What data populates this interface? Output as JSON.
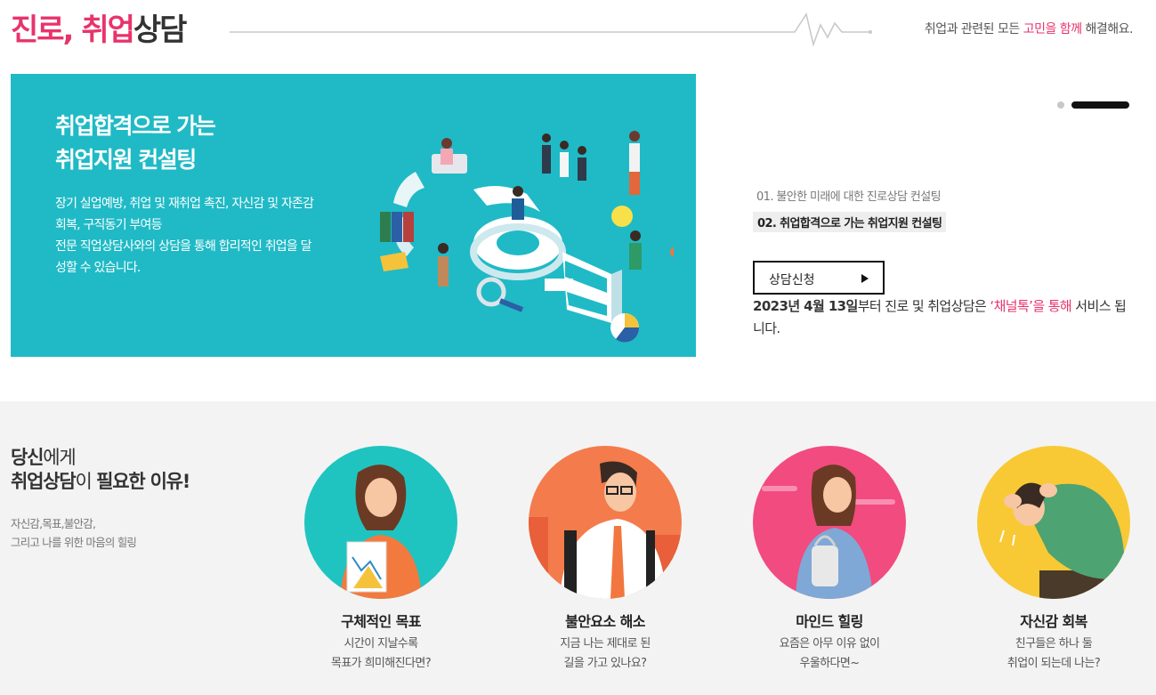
{
  "header": {
    "title_pink": "진로, 취업",
    "title_dark": "상담",
    "tagline_pre": "취업과 관련된 모든 ",
    "tagline_pink": "고민을 함께",
    "tagline_post": " 해결해요."
  },
  "banner": {
    "title_line1": "취업합격으로 가는",
    "title_line2": "취업지원 컨설팅",
    "desc_line1": "장기 실업예방, 취업 및 재취업 촉진, 자신감 및 자존감",
    "desc_line2": "회복, 구직동기 부여등",
    "desc_line3": "전문 직업상담사와의 상담을 통해 합리적인 취업을 달",
    "desc_line4": "성할 수 있습니다."
  },
  "slider": {
    "items": [
      {
        "label": "01. 불안한 미래에 대한 진로상담 컨설팅"
      },
      {
        "label": "02. 취업합격으로 가는 취업지원 컨설팅"
      }
    ],
    "active_index": 2,
    "total": 2
  },
  "consult": {
    "button_label": "상담신청",
    "notice_bold": "2023년 4월 13일",
    "notice_mid": "부터 진로 및 취업상담은 ",
    "notice_pink": "‘채널톡’을 통해",
    "notice_post": " 서비스 됩니다."
  },
  "reasons": {
    "heading_line1_bold": "당신",
    "heading_line1_rest": "에게",
    "heading_line2_bold1": "취업상담",
    "heading_line2_mid": "이 ",
    "heading_line2_bold2": "필요한 이유!",
    "sub_line1": "자신감,목표,불안감,",
    "sub_line2": "그리고 나를 위한 마음의 힐링",
    "cards": [
      {
        "title": "구체적인 목표",
        "desc_line1": "시간이 지날수록",
        "desc_line2": "목표가 희미해진다면?",
        "bg": "#1fc4c0"
      },
      {
        "title": "불안요소 해소",
        "desc_line1": "지금 나는 제대로 된",
        "desc_line2": "길을 가고 있나요?",
        "bg": "#f47b4c"
      },
      {
        "title": "마인드 힐링",
        "desc_line1": "요즘은 아무 이유 없이",
        "desc_line2": "우울하다면~",
        "bg": "#f24b7f"
      },
      {
        "title": "자신감 회복",
        "desc_line1": "친구들은 하나 둘",
        "desc_line2": "취업이 되는데 나는?",
        "bg": "#f8c934"
      }
    ]
  },
  "colors": {
    "accent_pink": "#e8336b",
    "banner_teal": "#1fbac6",
    "section_bg": "#f3f3f3"
  }
}
